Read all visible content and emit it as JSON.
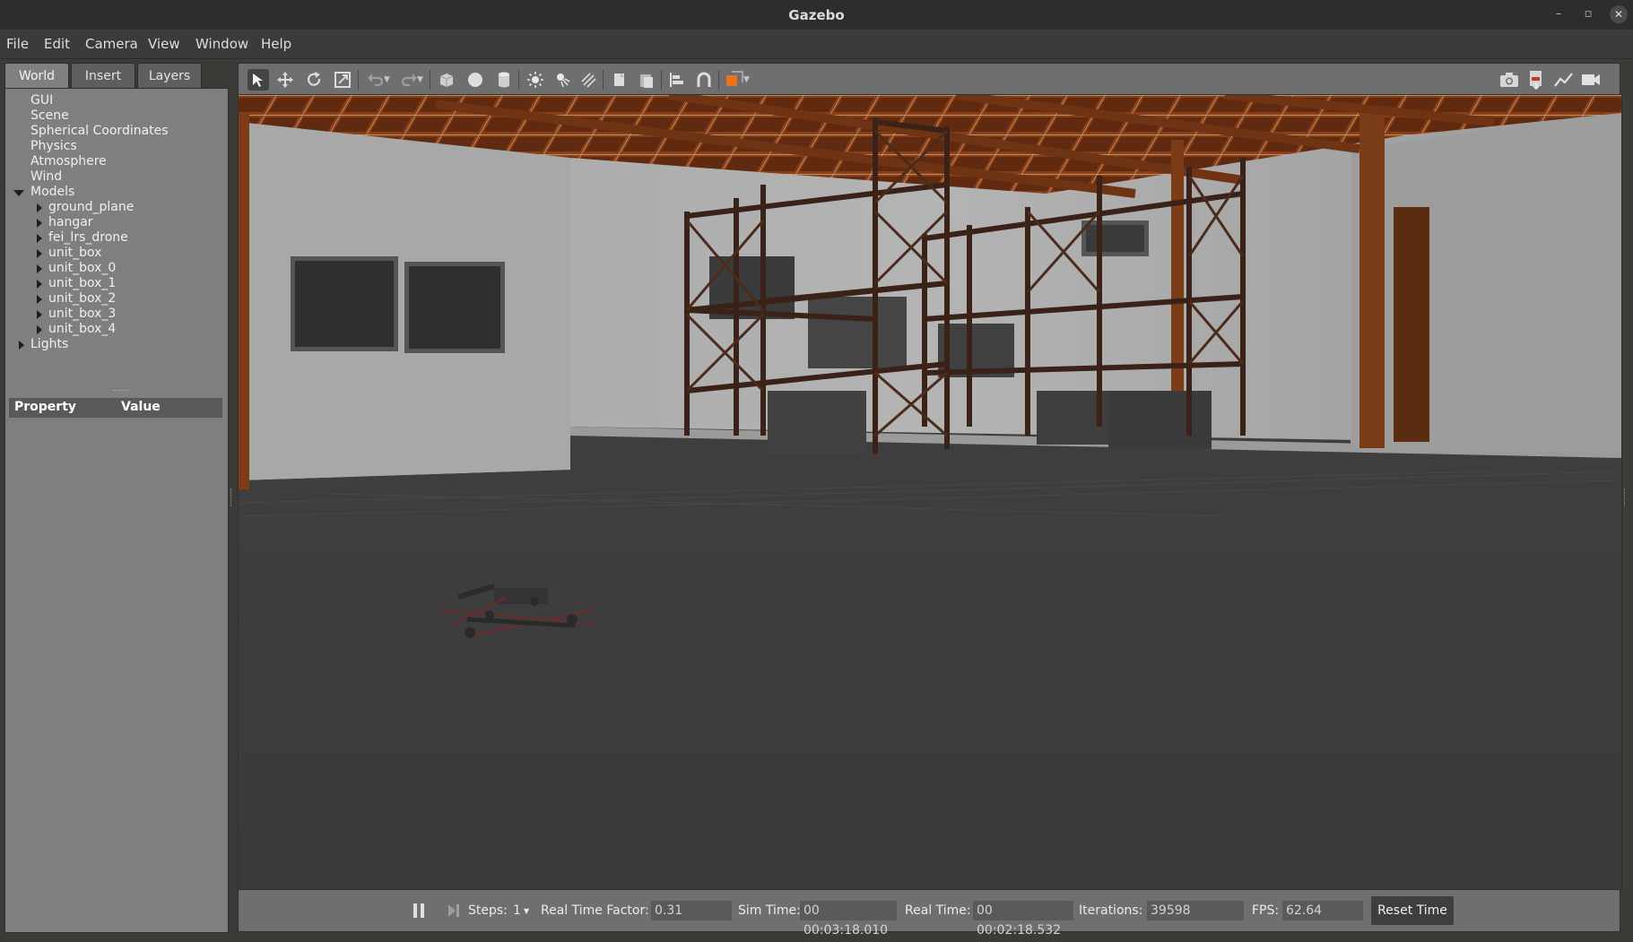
{
  "window": {
    "title": "Gazebo",
    "minimize": "–",
    "maximize": "▫",
    "close": "✕"
  },
  "menu": [
    "File",
    "Edit",
    "Camera",
    "View",
    "Window",
    "Help"
  ],
  "tabs": [
    "World",
    "Insert",
    "Layers"
  ],
  "tree": {
    "items": [
      "GUI",
      "Scene",
      "Spherical Coordinates",
      "Physics",
      "Atmosphere",
      "Wind"
    ],
    "models_label": "Models",
    "models": [
      "ground_plane",
      "hangar",
      "fei_lrs_drone",
      "unit_box",
      "unit_box_0",
      "unit_box_1",
      "unit_box_2",
      "unit_box_3",
      "unit_box_4"
    ],
    "lights_label": "Lights"
  },
  "properties": {
    "col_property": "Property",
    "col_value": "Value"
  },
  "toolbar": {
    "icons": [
      "select-mode-icon",
      "translate-icon",
      "rotate-icon",
      "scale-icon",
      "undo-icon",
      "redo-icon",
      "box-icon",
      "sphere-icon",
      "cylinder-icon",
      "point-light-icon",
      "spot-light-icon",
      "directional-light-icon",
      "copy-icon",
      "paste-icon",
      "align-icon",
      "snap-icon",
      "view-angle-icon",
      "screenshot-icon",
      "log-icon",
      "plot-icon",
      "record-video-icon"
    ]
  },
  "status": {
    "steps_label": "Steps:",
    "steps_value": "1",
    "rtf_label": "Real Time Factor:",
    "rtf_value": "0.31",
    "sim_time_label": "Sim Time:",
    "sim_time_value": "00 00:03:18.010",
    "real_time_label": "Real Time:",
    "real_time_value": "00 00:02:18.532",
    "iterations_label": "Iterations:",
    "iterations_value": "39598",
    "fps_label": "FPS:",
    "fps_value": "62.64",
    "reset_label": "Reset Time"
  },
  "colors": {
    "panel": "#7f7f7f",
    "toolbar": "#6f6f6f",
    "titlebar": "#2d2d2d",
    "ceiling_wood": "#7a3a18",
    "rack": "#3a2218",
    "floor": "#3d3d3d",
    "selected_orange": "#e8731e"
  }
}
